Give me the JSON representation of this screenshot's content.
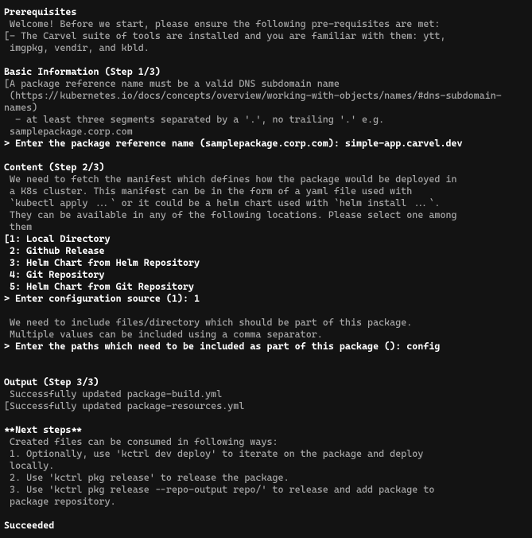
{
  "sections": {
    "prereq": {
      "heading": "Prerequisites",
      "l1": " Welcome! Before we start, please ensure the following pre-requisites are met:",
      "l2": "[- The Carvel suite of tools are installed and you are familiar with them: ytt,",
      "l3": " imgpkg, vendir, and kbld."
    },
    "basic": {
      "heading": "Basic Information (Step 1/3)",
      "l1": "[A package reference name must be a valid DNS subdomain name",
      "l2": " (https://kubernetes.io/docs/concepts/overview/working-with-objects/names/#dns-subdomain-names)",
      "l3": "  - at least three segments separated by a '.', no trailing '.' e.g.",
      "l4": " samplepackage.corp.com",
      "prompt": "> Enter the package reference name (samplepackage.corp.com): simple-app.carvel.dev"
    },
    "content": {
      "heading": "Content (Step 2/3)",
      "l1": " We need to fetch the manifest which defines how the package would be deployed in",
      "l2": " a K8s cluster. This manifest can be in the form of a yaml file used with",
      "l3": " `kubectl apply ...` or it could be a helm chart used with `helm install ...`.",
      "l4": " They can be available in any of the following locations. Please select one among",
      "l5": " them",
      "opt1": "[1: Local Directory",
      "opt2": " 2: Github Release",
      "opt3": " 3: Helm Chart from Helm Repository",
      "opt4": " 4: Git Repository",
      "opt5": " 5: Helm Chart from Git Repository",
      "prompt1": "> Enter configuration source (1): 1",
      "l6": " We need to include files/directory which should be part of this package.",
      "l7": " Multiple values can be included using a comma separator.",
      "prompt2": "> Enter the paths which need to be included as part of this package (): config"
    },
    "output": {
      "heading": "Output (Step 3/3)",
      "l1": " Successfully updated package-build.yml",
      "l2": "[Successfully updated package-resources.yml"
    },
    "next": {
      "heading": "**Next steps**",
      "l1": " Created files can be consumed in following ways:",
      "l2": " 1. Optionally, use 'kctrl dev deploy' to iterate on the package and deploy",
      "l3": " locally.",
      "l4": " 2. Use 'kctrl pkg release' to release the package.",
      "l5": " 3. Use 'kctrl pkg release --repo-output repo/' to release and add package to",
      "l6": " package repository."
    },
    "status": "Succeeded"
  }
}
